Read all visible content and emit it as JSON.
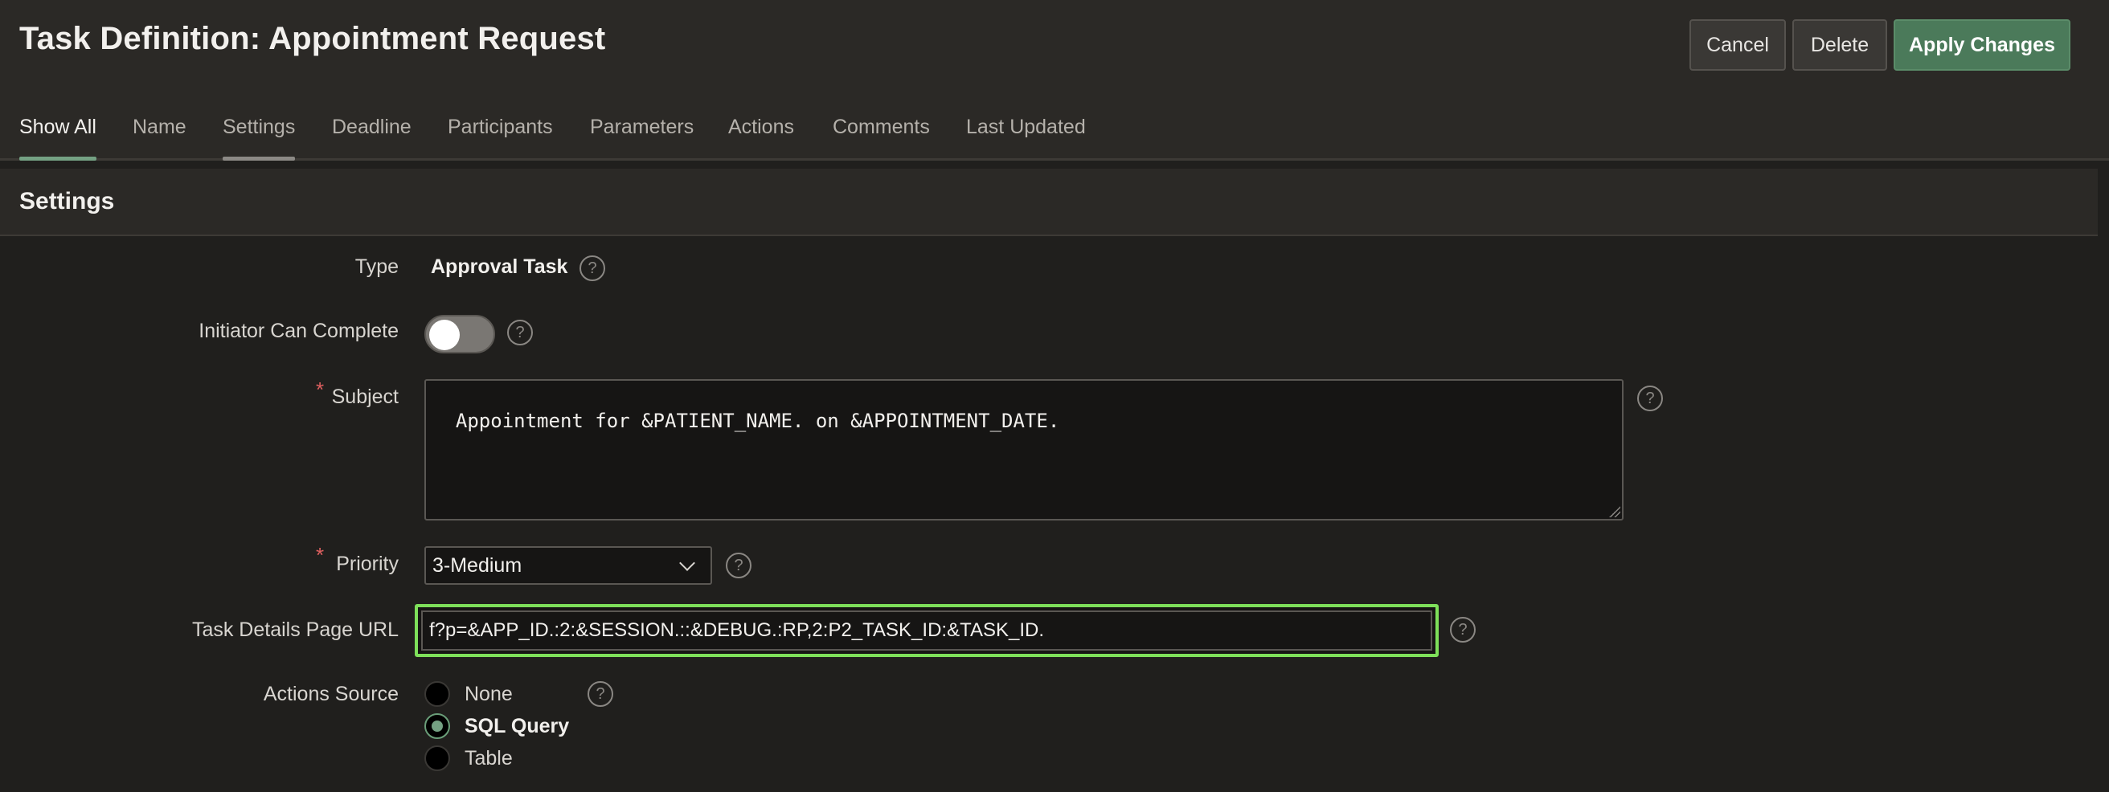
{
  "header": {
    "title": "Task Definition: Appointment Request",
    "cancel_label": "Cancel",
    "delete_label": "Delete",
    "apply_label": "Apply Changes"
  },
  "tabs": [
    {
      "label": "Show All",
      "active": true
    },
    {
      "label": "Name"
    },
    {
      "label": "Settings",
      "hover": true
    },
    {
      "label": "Deadline"
    },
    {
      "label": "Participants"
    },
    {
      "label": "Parameters"
    },
    {
      "label": "Actions"
    },
    {
      "label": "Comments"
    },
    {
      "label": "Last Updated"
    }
  ],
  "section": {
    "title": "Settings"
  },
  "form": {
    "type": {
      "label": "Type",
      "value": "Approval Task",
      "help_icon": "help-icon"
    },
    "initiator": {
      "label": "Initiator Can Complete",
      "value": false,
      "help_icon": "help-icon"
    },
    "subject": {
      "label": "Subject",
      "required_mark": "*",
      "value": "Appointment for &PATIENT_NAME. on &APPOINTMENT_DATE.",
      "help_icon": "help-icon"
    },
    "priority": {
      "label": "Priority",
      "required_mark": "*",
      "value": "3-Medium",
      "help_icon": "help-icon"
    },
    "task_url": {
      "label": "Task Details Page URL",
      "value": "f?p=&APP_ID.:2:&SESSION.::&DEBUG.:RP,2:P2_TASK_ID:&TASK_ID.",
      "help_icon": "help-icon"
    },
    "actions_source": {
      "label": "Actions Source",
      "help_icon": "help-icon",
      "options": [
        {
          "label": "None",
          "checked": false
        },
        {
          "label": "SQL Query",
          "checked": true
        },
        {
          "label": "Table",
          "checked": false
        }
      ]
    }
  },
  "help_glyph": "?",
  "colors": {
    "accent_green": "#74a183",
    "focus_outline": "#7ee05a",
    "primary_button": "#4b7a5a",
    "required": "#e06060"
  }
}
